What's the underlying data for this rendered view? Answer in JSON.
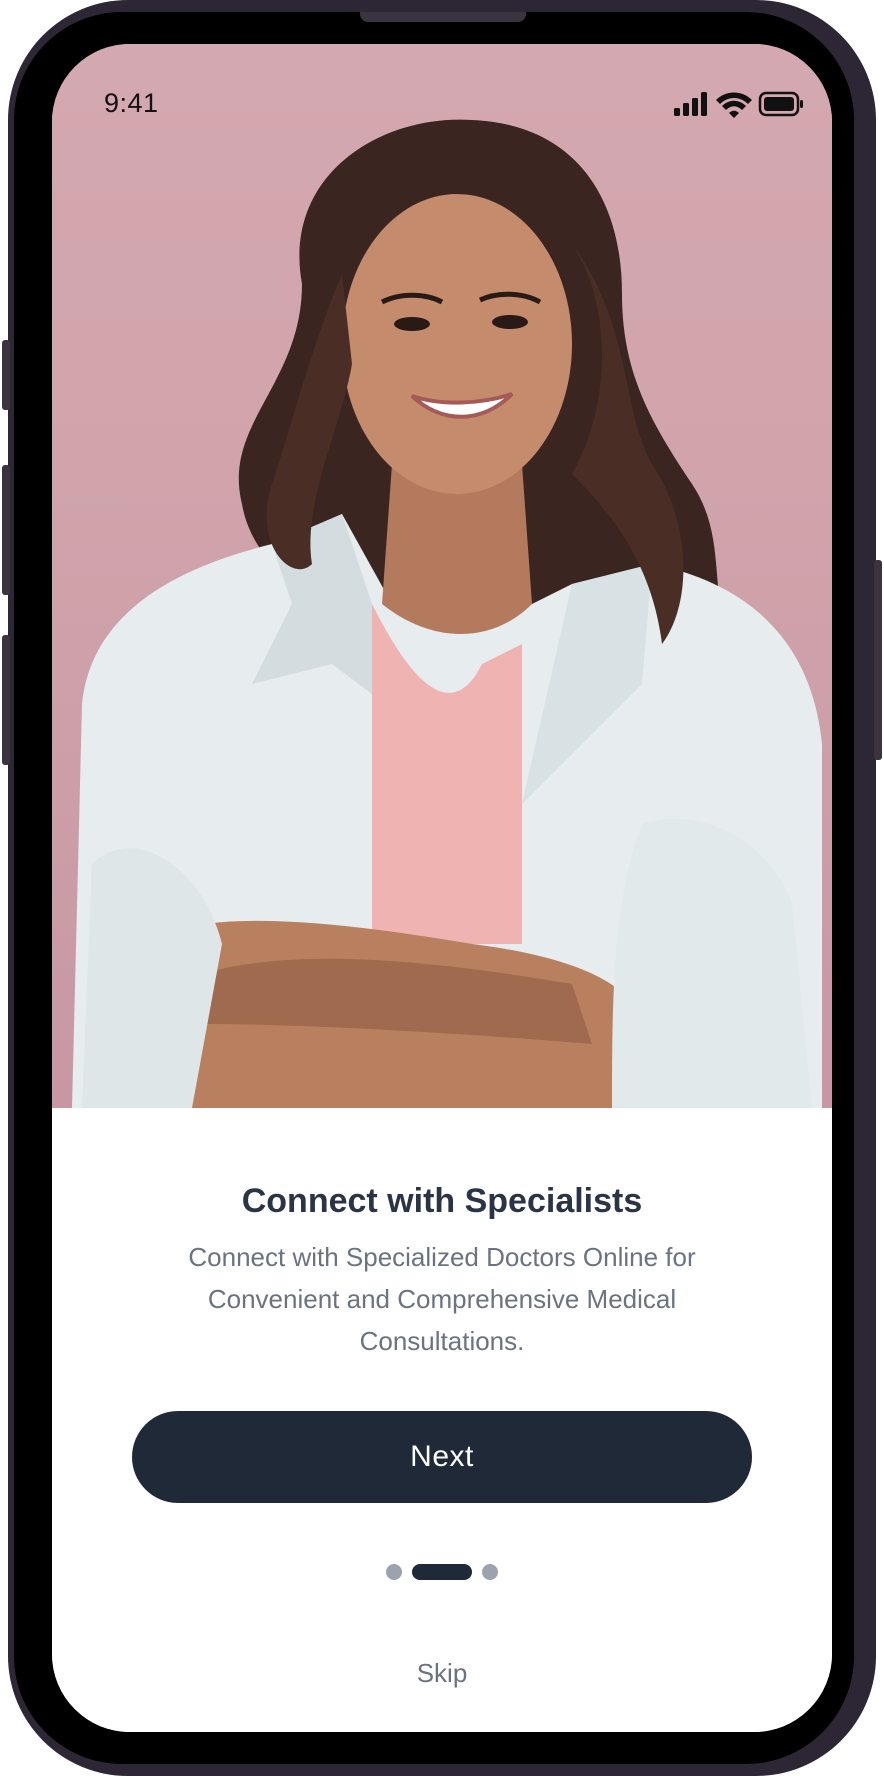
{
  "status_bar": {
    "time": "9:41"
  },
  "onboarding": {
    "title": "Connect with Specialists",
    "description": "Connect with Specialized Doctors Online for Convenient and Comprehensive Medical Consultations.",
    "next_label": "Next",
    "skip_label": "Skip",
    "page_indicator": {
      "total": 3,
      "current": 2
    }
  },
  "colors": {
    "photo_background": "#d1a4ac",
    "primary_button": "#1f2937",
    "title_text": "#2a3444",
    "body_text": "#6b7280",
    "inactive_dot": "#9ca3af"
  },
  "icons": [
    "signal-icon",
    "wifi-icon",
    "battery-icon"
  ]
}
